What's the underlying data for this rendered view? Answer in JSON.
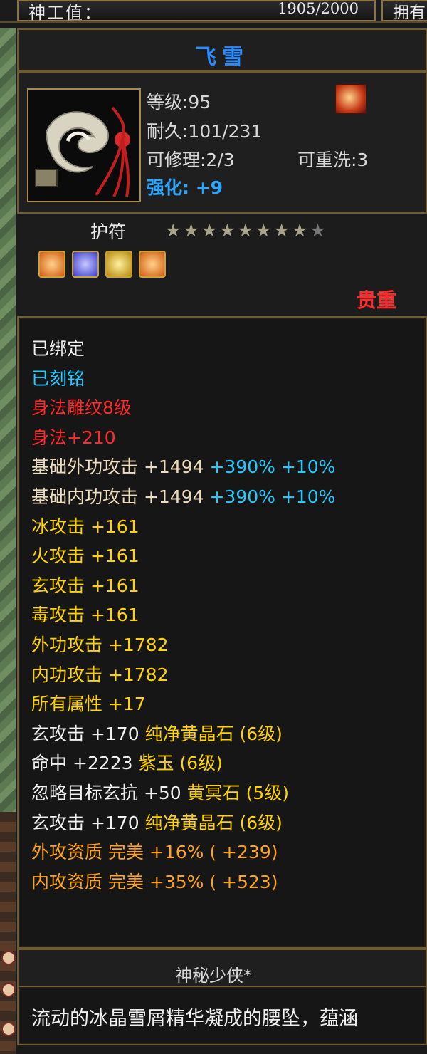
{
  "topbar": {
    "label": "神工值：",
    "value": "1905/2000",
    "right_label": "拥有"
  },
  "item": {
    "name": "飞雪",
    "level": "等级:95",
    "durability": "耐久:101/231",
    "repairable": "可修理:2/3",
    "rewash": "可重洗:3",
    "enhance": "强化: +9",
    "amulet_label": "护符",
    "stars_filled": "★★★★★★★★",
    "stars_empty": "★",
    "rarity": "贵重",
    "gems": [
      "gem-orange",
      "gem-blue",
      "gem-yellow",
      "gem-orange"
    ]
  },
  "attributes": [
    {
      "text": "已绑定",
      "color": "white"
    },
    {
      "text": "已刻铭",
      "color": "cyan"
    },
    {
      "text": "身法雕纹8级",
      "color": "red"
    },
    {
      "text": "身法+210",
      "color": "red"
    },
    {
      "text": "基础外功攻击 +1494",
      "extra": " +390% +10%",
      "color": "beige"
    },
    {
      "text": "基础内功攻击 +1494",
      "extra": " +390% +10%",
      "color": "beige"
    },
    {
      "text": "冰攻击 +161",
      "color": "yellow"
    },
    {
      "text": "火攻击 +161",
      "color": "yellow"
    },
    {
      "text": "玄攻击 +161",
      "color": "yellow"
    },
    {
      "text": "毒攻击 +161",
      "color": "yellow"
    },
    {
      "text": "外功攻击 +1782",
      "color": "yellow"
    },
    {
      "text": "内功攻击 +1782",
      "color": "yellow"
    },
    {
      "text": "所有属性 +17",
      "color": "yellow"
    },
    {
      "text": "玄攻击 +170 ",
      "extra": "纯净黄晶石 (6级)",
      "color": "white",
      "extra_color": "yellow"
    },
    {
      "text": "命中 +2223 ",
      "extra": "紫玉 (6级)",
      "color": "white",
      "extra_color": "yellow"
    },
    {
      "text": "忽略目标玄抗 +50 ",
      "extra": "黄冥石 (5级)",
      "color": "white",
      "extra_color": "yellow"
    },
    {
      "text": "玄攻击 +170 ",
      "extra": "纯净黄晶石 (6级)",
      "color": "white",
      "extra_color": "yellow"
    },
    {
      "text": "外攻资质  完美 +16% ( +239)",
      "color": "orange"
    },
    {
      "text": "内攻资质  完美 +35% ( +523)",
      "color": "orange"
    }
  ],
  "owner": "神秘少侠*",
  "description": "流动的冰晶雪屑精华凝成的腰坠，蕴涵"
}
